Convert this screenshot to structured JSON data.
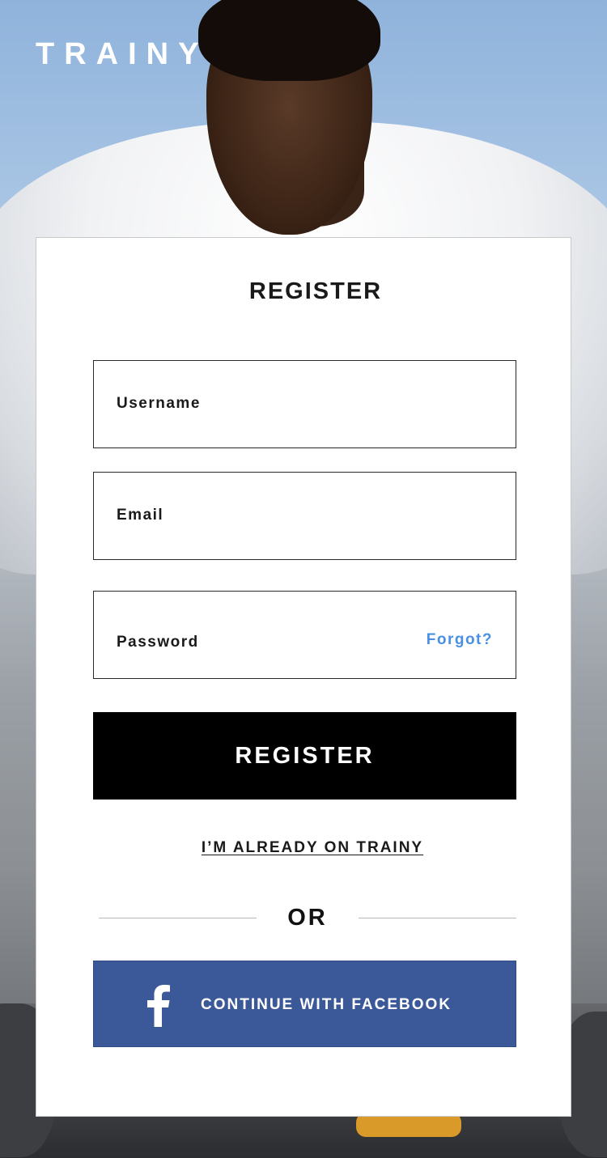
{
  "brand": {
    "name": "TRAINY"
  },
  "card": {
    "title": "REGISTER",
    "fields": {
      "username_label": "Username",
      "email_label": "Email",
      "password_label": "Password",
      "forgot_label": "Forgot?"
    },
    "register_button_label": "REGISTER",
    "login_link_label": "I’M ALREADY ON TRAINY",
    "divider_label": "OR",
    "facebook_button_label": "CONTINUE WITH FACEBOOK"
  },
  "colors": {
    "primary_button": "#000000",
    "facebook": "#3b5998",
    "link_accent": "#4a90e2",
    "card_background": "#ffffff"
  },
  "icons": {
    "facebook": "facebook-icon"
  }
}
